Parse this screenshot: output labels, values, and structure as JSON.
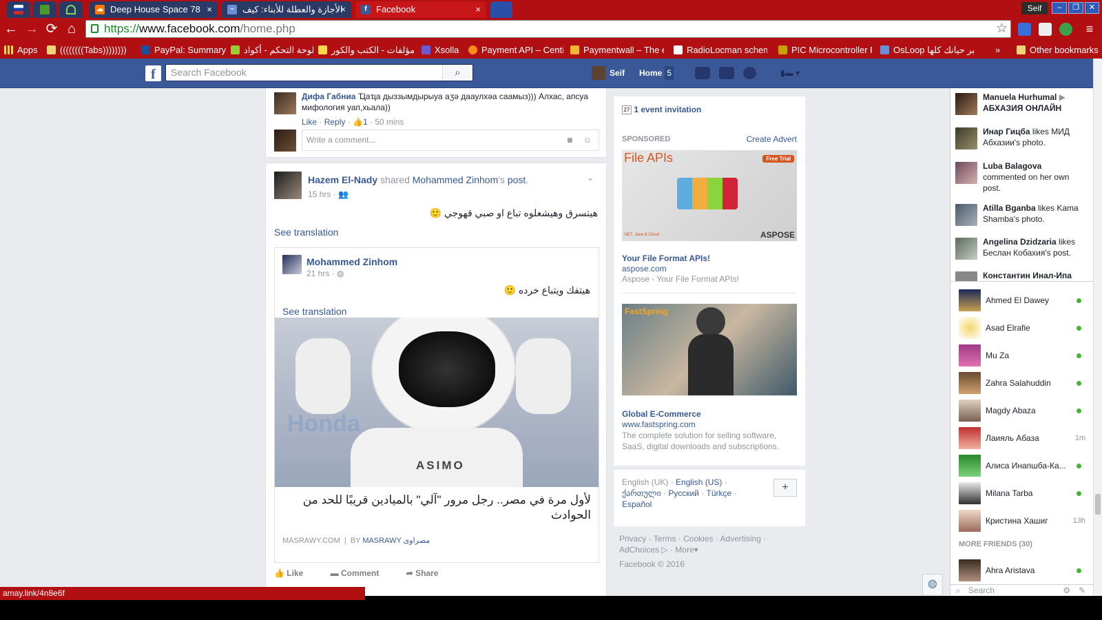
{
  "browser": {
    "tabs": [
      {
        "title": "Deep House Space 78"
      },
      {
        "title": "الأجازة والعطلة للأبناء: كيف"
      },
      {
        "title": "Facebook"
      }
    ],
    "profile_name": "Seif",
    "url_scheme": "https://",
    "url_host": "www.facebook.com",
    "url_path": "/home.php",
    "bookmarks": [
      "Apps",
      "((((((((Tabs))))))))",
      "PayPal: Summary",
      "لوحة التحكم - أكواد",
      "مؤلفات - الكتب والكور",
      "Xsolla",
      "Payment API – Centi",
      "Paymentwall – The e",
      "RadioLocman schem",
      "PIC Microcontroller F",
      "OsLoop خبر حيانك كلها",
      "»",
      "Other bookmarks"
    ],
    "status_url": "amay.link/4n8e6f",
    "accent": "#b10f12"
  },
  "fb": {
    "search_placeholder": "Search Facebook",
    "user_name": "Seif",
    "home_label": "Home",
    "home_count": "5",
    "brand_color": "#3b5998"
  },
  "feed": {
    "comment": {
      "author": "Дифа Габниа",
      "text": "Ҵаҵа дыззымдырыуа аӡә дааулхәа саамыз))) Алхас, апсуа мифология уап,хьала))",
      "like": "Like",
      "reply": "Reply",
      "likes": "1",
      "time": "50 mins",
      "write_placeholder": "Write a comment..."
    },
    "post": {
      "author": "Hazem El-Nady",
      "shared": "shared",
      "orig_author_link": "Mohammed Zinhom",
      "possessive": "'s",
      "post_word": "post",
      "period": ".",
      "time": "15 hrs",
      "text": "هيتسرق وهيشغلوه تباع او صبي قهوجي",
      "see_translation": "See translation",
      "shared_post": {
        "author": "Mohammed Zinhom",
        "time": "21 hrs",
        "text": "هيتفك ويتباع خرده",
        "see_translation": "See translation",
        "image_label": "ASIMO",
        "image_bg_text": "Honda",
        "headline": "لأول مرة في مصر.. رجل مرور \"آلي\" بالميادين قريبًا للحد من الحوادث",
        "source": "MASRAWY.COM",
        "by": "BY",
        "publisher": "MASRAWY مصراوى"
      },
      "actions": [
        "Like",
        "Comment",
        "Share"
      ]
    }
  },
  "right_col": {
    "events": "1 event invitation",
    "events_day": "27",
    "sponsored": "SPONSORED",
    "create_advert": "Create Advert",
    "ads": [
      {
        "image_title": "File APIs",
        "badge": "Free Trial",
        "brand": "ASPOSE",
        "footer_small": ".NET, Java & Cloud",
        "title": "Your File Format APIs!",
        "url": "aspose.com",
        "desc": "Aspose - Your File Format APIs!"
      },
      {
        "image_title": "FastSpring",
        "title": "Global E-Commerce",
        "url": "www.fastspring.com",
        "desc": "The complete solution for selling software, SaaS, digital downloads and subscriptions."
      }
    ],
    "languages": [
      "English (UK)",
      "English (US)",
      "ქართული",
      "Русский",
      "Türkçe",
      "Español"
    ],
    "add_lang": "+",
    "footer_links": [
      "Privacy",
      "Terms",
      "Cookies",
      "Advertising",
      "AdChoices",
      "More"
    ],
    "copyright": "Facebook © 2016"
  },
  "ticker": [
    {
      "name": "Manuela Hurhumal",
      "arrow": "▶",
      "rest": "АБХАЗИЯ ОНЛАЙН",
      "bold_rest": true
    },
    {
      "name": "Инар Гицба",
      "rest": "likes МИД Абхазии's photo."
    },
    {
      "name": "Luba Balagova",
      "rest": "commented on her own post."
    },
    {
      "name": "Atilla Bganba",
      "rest": "likes Kama Shamba's photo."
    },
    {
      "name": "Angelina Dzidzaria",
      "rest": "likes Беслан Кобахия's post."
    },
    {
      "name": "Константин Инал-Ипа",
      "rest": ""
    }
  ],
  "friends": [
    {
      "name": "Ahmed El Dawey",
      "status": "online"
    },
    {
      "name": "Asad Elrafie",
      "status": "online"
    },
    {
      "name": "Mu Za",
      "status": "online"
    },
    {
      "name": "Zahra Salahuddin",
      "status": "online"
    },
    {
      "name": "Magdy Abaza",
      "status": "online"
    },
    {
      "name": "Лаияль Абаза",
      "status": "1m"
    },
    {
      "name": "Алиса Инапшба-Ка...",
      "status": "online"
    },
    {
      "name": "Milana Tarba",
      "status": "online"
    },
    {
      "name": "Кристина Хашиг",
      "status": "13h"
    }
  ],
  "more_friends": "MORE FRIENDS (30)",
  "more_friends_list": [
    {
      "name": "Ahra Aristava",
      "status": "online"
    }
  ],
  "chat_search_placeholder": "Search"
}
